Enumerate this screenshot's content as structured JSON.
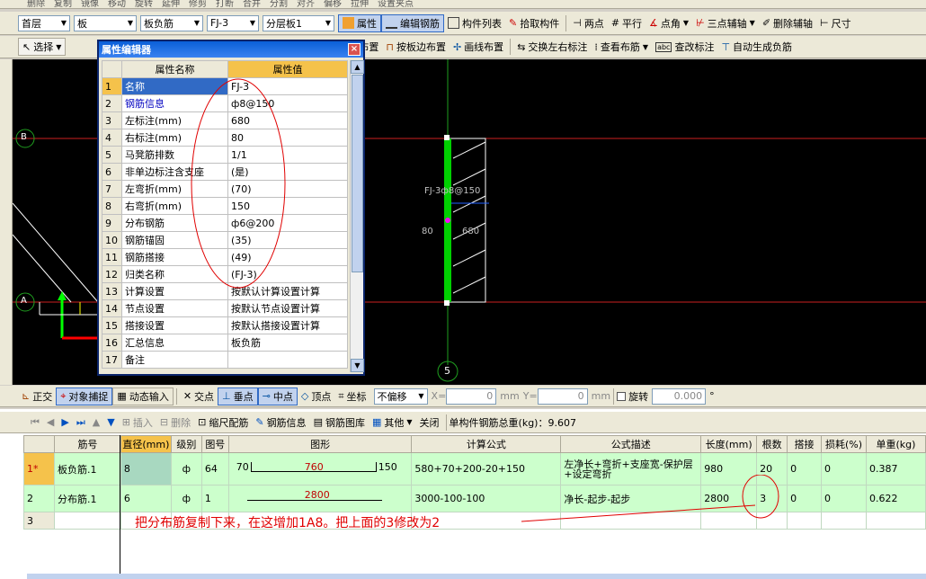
{
  "toolbar_top": {
    "items": [
      "删除",
      "复制",
      "镜像",
      "移动",
      "旋转",
      "延伸",
      "修剪",
      "打断",
      "合并",
      "分割",
      "对齐",
      "偏移",
      "拉伸",
      "设置夹点"
    ]
  },
  "toolbar1": {
    "floor": "首层",
    "category": "板",
    "type": "板负筋",
    "component": "FJ-3",
    "layer": "分层板1",
    "buttons": [
      "属性",
      "编辑钢筋",
      "构件列表",
      "拾取构件",
      "两点",
      "平行",
      "点角",
      "三点辅轴",
      "删除辅轴",
      "尺寸"
    ]
  },
  "toolbar2": {
    "select": "选择",
    "buttons": [
      "按墙布置",
      "按板边布置",
      "画线布置",
      "交换左右标注",
      "查看布筋",
      "查改标注",
      "自动生成负筋"
    ]
  },
  "prop_editor": {
    "title": "属性编辑器",
    "col_name": "属性名称",
    "col_value": "属性值",
    "close": "×",
    "rows": [
      {
        "no": "1",
        "name": "名称",
        "value": "FJ-3"
      },
      {
        "no": "2",
        "name": "钢筋信息",
        "value": "ф8@150"
      },
      {
        "no": "3",
        "name": "左标注(mm)",
        "value": "680"
      },
      {
        "no": "4",
        "name": "右标注(mm)",
        "value": "80"
      },
      {
        "no": "5",
        "name": "马凳筋排数",
        "value": "1/1"
      },
      {
        "no": "6",
        "name": "非单边标注含支座",
        "value": "(是)"
      },
      {
        "no": "7",
        "name": "左弯折(mm)",
        "value": "(70)"
      },
      {
        "no": "8",
        "name": "右弯折(mm)",
        "value": "150"
      },
      {
        "no": "9",
        "name": "分布钢筋",
        "value": "ф6@200"
      },
      {
        "no": "10",
        "name": "钢筋锚固",
        "value": "(35)"
      },
      {
        "no": "11",
        "name": "钢筋搭接",
        "value": "(49)"
      },
      {
        "no": "12",
        "name": "归类名称",
        "value": "(FJ-3)"
      },
      {
        "no": "13",
        "name": "计算设置",
        "value": "按默认计算设置计算"
      },
      {
        "no": "14",
        "name": "节点设置",
        "value": "按默认节点设置计算"
      },
      {
        "no": "15",
        "name": "搭接设置",
        "value": "按默认搭接设置计算"
      },
      {
        "no": "16",
        "name": "汇总信息",
        "value": "板负筋"
      },
      {
        "no": "17",
        "name": "备注",
        "value": ""
      }
    ]
  },
  "canvas": {
    "axis_b": "B",
    "axis_a": "A",
    "axis_5": "5",
    "label_fj": "FJ-3ф8@150",
    "label_80": "80",
    "label_680": "680"
  },
  "snapbar": {
    "items": [
      "正交",
      "对象捕捉",
      "动态输入",
      "交点",
      "垂点",
      "中点",
      "顶点",
      "坐标"
    ],
    "offset_mode": "不偏移",
    "x_label": "X=",
    "x_value": "0",
    "y_label": "Y=",
    "y_value": "0",
    "mm": "mm",
    "rotate": "旋转",
    "rotate_value": "0.000",
    "deg": "°"
  },
  "rebar_toolbar": {
    "items": [
      "插入",
      "删除",
      "缩尺配筋",
      "钢筋信息",
      "钢筋图库",
      "其他",
      "关闭"
    ],
    "total": "单构件钢筋总重(kg)：9.607"
  },
  "rebar_table": {
    "headers": [
      "筋号",
      "直径(mm)",
      "级别",
      "图号",
      "图形",
      "计算公式",
      "公式描述",
      "长度(mm)",
      "根数",
      "搭接",
      "损耗(%)",
      "单重(kg)"
    ],
    "rows": [
      {
        "rn": "1*",
        "name": "板负筋.1",
        "dia": "8",
        "grade": "ф",
        "fig": "64",
        "shape_l": "70",
        "shape_m": "760",
        "shape_r": "150",
        "formula": "580+70+200-20+150",
        "desc": "左净长+弯折+支座宽-保护层+设定弯折",
        "len": "980",
        "count": "20",
        "lap": "0",
        "loss": "0",
        "weight": "0.387"
      },
      {
        "rn": "2",
        "name": "分布筋.1",
        "dia": "6",
        "grade": "ф",
        "fig": "1",
        "shape_l": "",
        "shape_m": "2800",
        "shape_r": "",
        "formula": "3000-100-100",
        "desc": "净长-起步-起步",
        "len": "2800",
        "count": "3",
        "lap": "0",
        "loss": "0",
        "weight": "0.622"
      },
      {
        "rn": "3",
        "name": "",
        "dia": "",
        "grade": "",
        "fig": "",
        "shape_l": "",
        "shape_m": "",
        "shape_r": "",
        "formula": "",
        "desc": "",
        "len": "",
        "count": "",
        "lap": "",
        "loss": "",
        "weight": ""
      }
    ]
  },
  "annotation": "把分布筋复制下来，在这增加1A8。把上面的3修改为2",
  "colors": {
    "highlight": "#f5c24b",
    "row_green": "#ccffcc",
    "annot_red": "#e00000",
    "rebar_green": "#00d000"
  }
}
